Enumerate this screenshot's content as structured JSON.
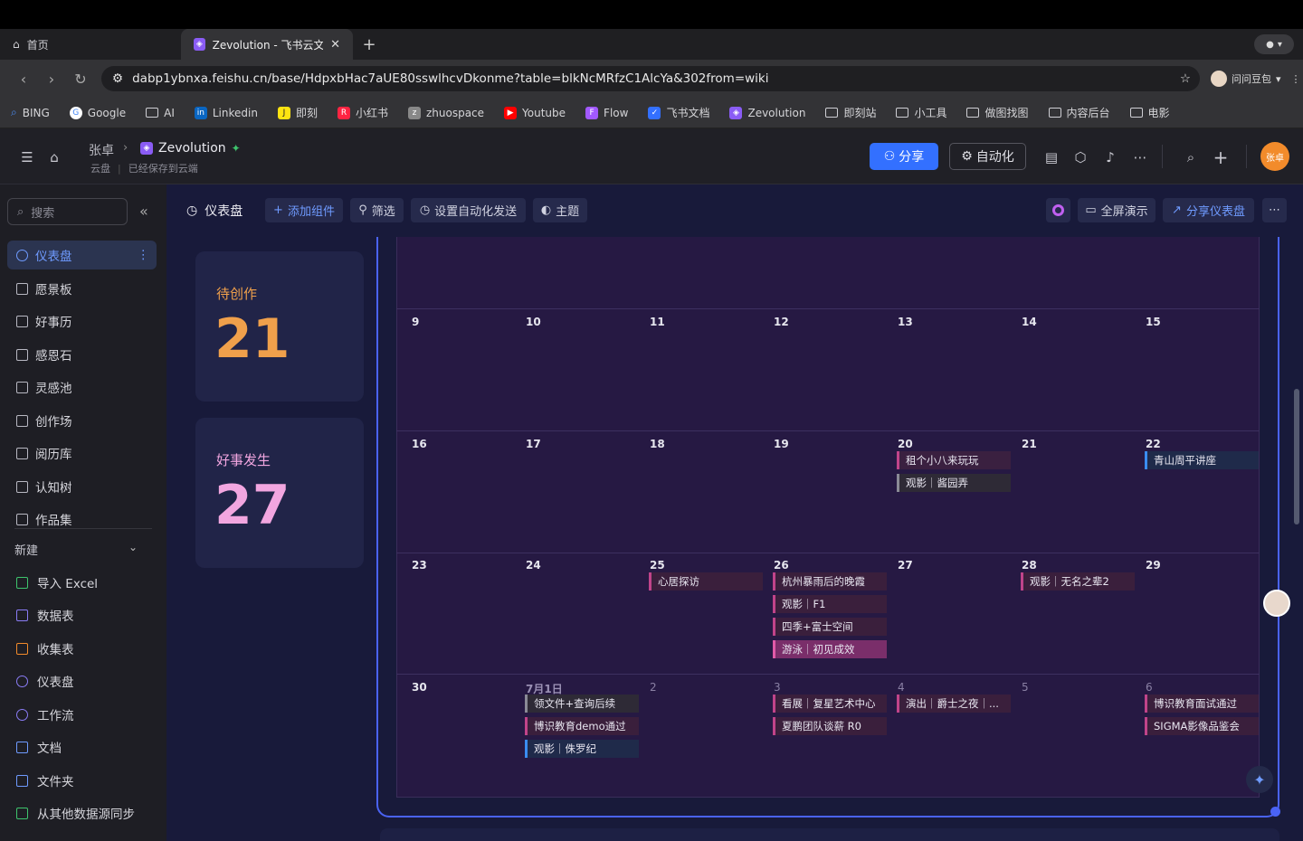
{
  "browser": {
    "tabs": [
      {
        "label": "首页",
        "icon": "home-icon"
      },
      {
        "label": "Zevolution - 飞书云文档",
        "icon": "zevolution-icon"
      }
    ],
    "url": "dabp1ybnxa.feishu.cn/base/HdpxbHac7aUE80sswlhcvDkonme?table=blkNcMRfzC1AlcYa&302from=wiki",
    "account_name": "问问豆包",
    "bookmarks": [
      {
        "label": "BING",
        "icon": "search-icon"
      },
      {
        "label": "Google",
        "icon": "google-icon"
      },
      {
        "label": "AI",
        "icon": "folder-icon"
      },
      {
        "label": "Linkedin",
        "icon": "linkedin-icon"
      },
      {
        "label": "即刻",
        "icon": "jike-icon"
      },
      {
        "label": "小红书",
        "icon": "xiaohongshu-icon"
      },
      {
        "label": "zhuospace",
        "icon": "zhuospace-icon"
      },
      {
        "label": "Youtube",
        "icon": "youtube-icon"
      },
      {
        "label": "Flow",
        "icon": "figma-icon"
      },
      {
        "label": "飞书文档",
        "icon": "feishu-icon"
      },
      {
        "label": "Zevolution",
        "icon": "zevolution-icon"
      },
      {
        "label": "即刻站",
        "icon": "folder-icon"
      },
      {
        "label": "小工具",
        "icon": "folder-icon"
      },
      {
        "label": "做图找图",
        "icon": "folder-icon"
      },
      {
        "label": "内容后台",
        "icon": "folder-icon"
      },
      {
        "label": "电影",
        "icon": "folder-icon"
      }
    ]
  },
  "header": {
    "breadcrumb_user": "张卓",
    "app_name": "Zevolution",
    "location": "云盘",
    "save_status": "已经保存到云端",
    "share_label": "分享",
    "automation_label": "自动化",
    "user_avatar_text": "张卓"
  },
  "sidebar": {
    "search_placeholder": "搜索",
    "items": [
      {
        "label": "仪表盘",
        "active": true
      },
      {
        "label": "愿景板"
      },
      {
        "label": "好事历"
      },
      {
        "label": "感恩石"
      },
      {
        "label": "灵感池"
      },
      {
        "label": "创作场"
      },
      {
        "label": "阅历库"
      },
      {
        "label": "认知树"
      },
      {
        "label": "作品集"
      }
    ],
    "new_label": "新建",
    "new_items": [
      {
        "label": "导入 Excel",
        "color": "#3ec46d"
      },
      {
        "label": "数据表",
        "color": "#8a7cf5"
      },
      {
        "label": "收集表",
        "color": "#f28b2b"
      },
      {
        "label": "仪表盘",
        "color": "#8a7cf5"
      },
      {
        "label": "工作流",
        "color": "#8a7cf5"
      },
      {
        "label": "文档",
        "color": "#6f9bff"
      },
      {
        "label": "文件夹",
        "color": "#6f9bff"
      },
      {
        "label": "从其他数据源同步",
        "color": "#3ec46d"
      }
    ]
  },
  "toolbar": {
    "title": "仪表盘",
    "add_component": "添加组件",
    "filter": "筛选",
    "auto_send": "设置自动化发送",
    "theme": "主题",
    "fullscreen": "全屏演示",
    "share_dashboard": "分享仪表盘"
  },
  "stats": [
    {
      "label": "待创作",
      "value": "21",
      "color": "#f0a04b"
    },
    {
      "label": "好事发生",
      "value": "27",
      "color": "#f2a6e0"
    }
  ],
  "calendar": {
    "weeks": [
      {
        "days": [
          "9",
          "10",
          "11",
          "12",
          "13",
          "14",
          "15"
        ]
      },
      {
        "days": [
          "16",
          "17",
          "18",
          "19",
          "20",
          "21",
          "22"
        ]
      },
      {
        "days": [
          "23",
          "24",
          "25",
          "26",
          "27",
          "28",
          "29"
        ]
      },
      {
        "days": [
          "30",
          "7月1日",
          "2",
          "3",
          "4",
          "5",
          "6"
        ]
      }
    ],
    "events": [
      {
        "week": 1,
        "day": 4,
        "slot": 0,
        "label": "租个小八来玩玩",
        "color": "#c0448a",
        "bg": "#3a2040"
      },
      {
        "week": 1,
        "day": 4,
        "slot": 1,
        "label": "观影｜酱园弄",
        "color": "#8a8a96",
        "bg": "#2e2a36"
      },
      {
        "week": 1,
        "day": 6,
        "slot": 0,
        "label": "青山周平讲座",
        "color": "#3a8cf0",
        "bg": "#1f2a4a"
      },
      {
        "week": 2,
        "day": 2,
        "slot": 0,
        "label": "心居探访",
        "color": "#c0448a",
        "bg": "#3a1f3c"
      },
      {
        "week": 2,
        "day": 3,
        "slot": 0,
        "label": "杭州暴雨后的晚霞",
        "color": "#c0448a",
        "bg": "#3a1f3c"
      },
      {
        "week": 2,
        "day": 3,
        "slot": 1,
        "label": "观影｜F1",
        "color": "#c0448a",
        "bg": "#3a1f3c"
      },
      {
        "week": 2,
        "day": 3,
        "slot": 2,
        "label": "四季+富士空间",
        "color": "#c0448a",
        "bg": "#3a1f3c"
      },
      {
        "week": 2,
        "day": 3,
        "slot": 3,
        "label": "游泳｜初见成效",
        "color": "#e05aa8",
        "bg": "#7a2e6a"
      },
      {
        "week": 2,
        "day": 5,
        "slot": 0,
        "label": "观影｜无名之辈2",
        "color": "#c0448a",
        "bg": "#3a1f3c"
      },
      {
        "week": 3,
        "day": 1,
        "slot": 0,
        "label": "领文件+查询后续",
        "color": "#8a8a96",
        "bg": "#2e2a36"
      },
      {
        "week": 3,
        "day": 1,
        "slot": 1,
        "label": "博识教育demo通过",
        "color": "#c0448a",
        "bg": "#3a1f3c"
      },
      {
        "week": 3,
        "day": 1,
        "slot": 2,
        "label": "观影｜侏罗纪",
        "color": "#3a8cf0",
        "bg": "#1f2a4a"
      },
      {
        "week": 3,
        "day": 3,
        "slot": 0,
        "label": "看展｜复星艺术中心",
        "color": "#c0448a",
        "bg": "#3a1f3c"
      },
      {
        "week": 3,
        "day": 3,
        "slot": 1,
        "label": "夏鹏团队谈薪 R0",
        "color": "#c0448a",
        "bg": "#3a1f3c"
      },
      {
        "week": 3,
        "day": 4,
        "slot": 0,
        "label": "演出｜爵士之夜｜...",
        "color": "#c0448a",
        "bg": "#3a1f3c"
      },
      {
        "week": 3,
        "day": 6,
        "slot": 0,
        "label": "博识教育面试通过",
        "color": "#c0448a",
        "bg": "#3a1f3c"
      },
      {
        "week": 3,
        "day": 6,
        "slot": 1,
        "label": "SIGMA影像品鉴会",
        "color": "#c0448a",
        "bg": "#3a1f3c"
      }
    ]
  }
}
